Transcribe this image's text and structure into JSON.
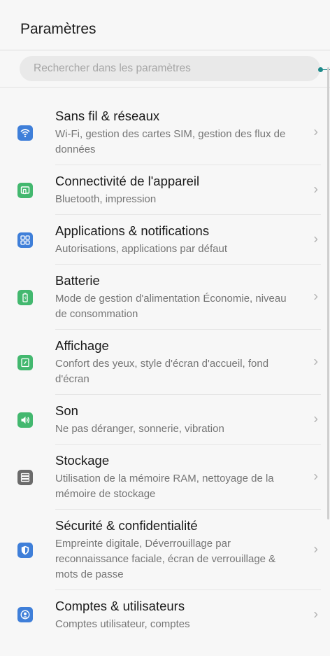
{
  "header": {
    "title": "Paramètres"
  },
  "search": {
    "placeholder": "Rechercher dans les paramètres"
  },
  "items": [
    {
      "title": "Sans fil & réseaux",
      "subtitle": "Wi-Fi, gestion des cartes SIM, gestion des flux de données",
      "icon": "wifi-icon",
      "color": "#3f7fd9"
    },
    {
      "title": "Connectivité de l'appareil",
      "subtitle": "Bluetooth, impression",
      "icon": "device-connectivity-icon",
      "color": "#43b86f"
    },
    {
      "title": "Applications & notifications",
      "subtitle": "Autorisations, applications par défaut",
      "icon": "apps-grid-icon",
      "color": "#3f7fd9"
    },
    {
      "title": "Batterie",
      "subtitle": "Mode de gestion d'alimentation Économie, niveau de consommation",
      "icon": "battery-icon",
      "color": "#43b86f"
    },
    {
      "title": "Affichage",
      "subtitle": "Confort des yeux, style d'écran d'accueil, fond d'écran",
      "icon": "display-icon",
      "color": "#43b86f"
    },
    {
      "title": "Son",
      "subtitle": "Ne pas déranger, sonnerie, vibration",
      "icon": "speaker-icon",
      "color": "#43b86f"
    },
    {
      "title": "Stockage",
      "subtitle": "Utilisation de la mémoire RAM, nettoyage de la mémoire de stockage",
      "icon": "storage-icon",
      "color": "#6b6b6b"
    },
    {
      "title": "Sécurité & confidentialité",
      "subtitle": "Empreinte digitale, Déverrouillage par reconnaissance faciale, écran de verrouillage & mots de passe",
      "icon": "shield-icon",
      "color": "#3f7fd9"
    },
    {
      "title": "Comptes & utilisateurs",
      "subtitle": "Comptes utilisateur, comptes",
      "icon": "account-icon",
      "color": "#3f7fd9"
    }
  ]
}
